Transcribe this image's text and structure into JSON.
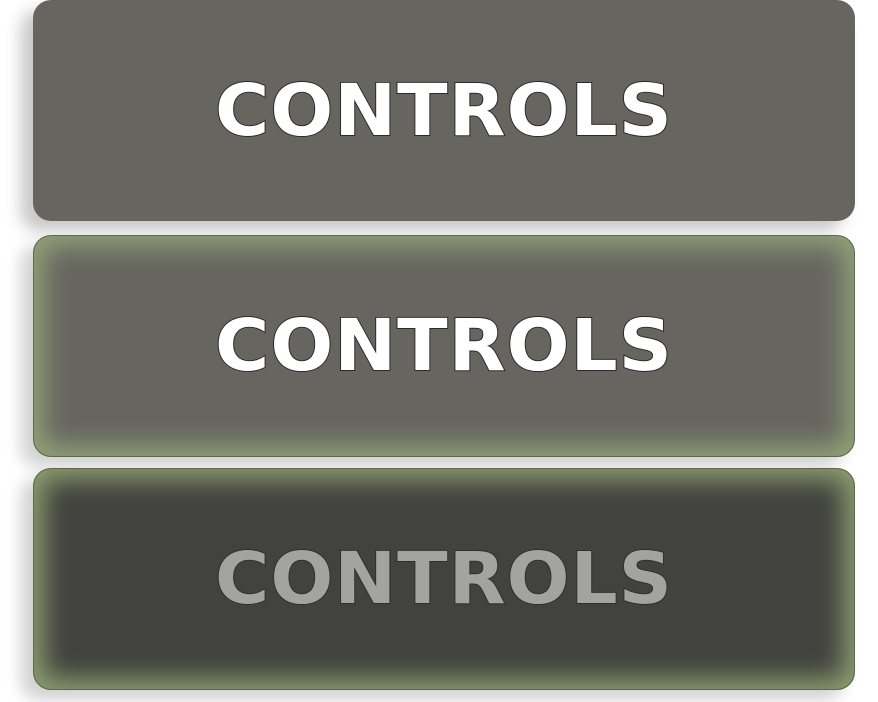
{
  "buttons": [
    {
      "state": "normal",
      "label": "CONTROLS",
      "background": "#666560",
      "text_color": "#ffffff"
    },
    {
      "state": "hover",
      "label": "CONTROLS",
      "background": "#666560",
      "glow": "#93a377",
      "text_color": "#ffffff"
    },
    {
      "state": "pressed",
      "label": "CONTROLS",
      "background": "#42423f",
      "glow": "#8ea071",
      "text_color": "#a3a3a0"
    }
  ]
}
